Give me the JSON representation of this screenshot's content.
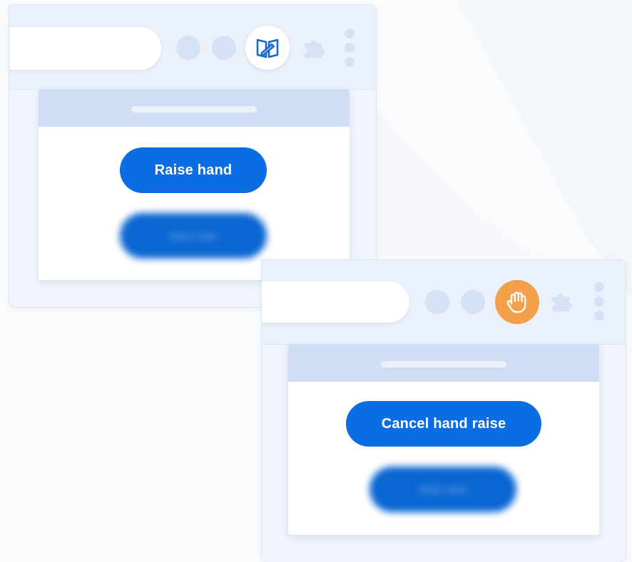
{
  "colors": {
    "primary_button": "#0b6de3",
    "hand_raised_badge": "#f4a04b",
    "toolbar_bg": "#ebf1fb",
    "popup_header": "#cfdef4"
  },
  "window_before": {
    "extension_icon": "book-pen-icon",
    "primary_button_label": "Raise hand",
    "secondary_button_label": "Start chat"
  },
  "window_after": {
    "extension_icon": "raised-hand-icon",
    "primary_button_label": "Cancel hand raise",
    "secondary_button_label": "Start chat"
  }
}
